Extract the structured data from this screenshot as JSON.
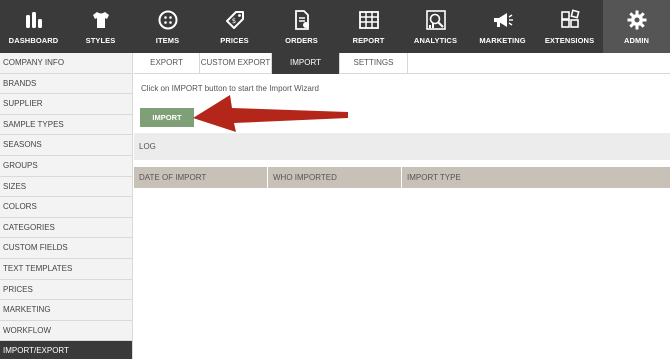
{
  "nav": {
    "items": [
      {
        "label": "DASHBOARD",
        "icon": "dashboard-icon"
      },
      {
        "label": "STYLES",
        "icon": "shirt-icon"
      },
      {
        "label": "ITEMS",
        "icon": "button-icon"
      },
      {
        "label": "PRICES",
        "icon": "price-tag-icon"
      },
      {
        "label": "ORDERS",
        "icon": "document-icon"
      },
      {
        "label": "REPORT",
        "icon": "table-icon"
      },
      {
        "label": "ANALYTICS",
        "icon": "analytics-icon"
      },
      {
        "label": "MARKETING",
        "icon": "megaphone-icon"
      },
      {
        "label": "EXTENSIONS",
        "icon": "extensions-icon"
      },
      {
        "label": "ADMIN",
        "icon": "gear-icon",
        "active": true
      }
    ]
  },
  "sidebar": {
    "items": [
      {
        "label": "COMPANY INFO"
      },
      {
        "label": "BRANDS"
      },
      {
        "label": "SUPPLIER"
      },
      {
        "label": "SAMPLE TYPES"
      },
      {
        "label": "SEASONS"
      },
      {
        "label": "GROUPS"
      },
      {
        "label": "SIZES"
      },
      {
        "label": "COLORS"
      },
      {
        "label": "CATEGORIES"
      },
      {
        "label": "CUSTOM FIELDS"
      },
      {
        "label": "TEXT TEMPLATES"
      },
      {
        "label": "PRICES"
      },
      {
        "label": "MARKETING"
      },
      {
        "label": "WORKFLOW"
      },
      {
        "label": "IMPORT/EXPORT",
        "active": true
      }
    ]
  },
  "tabs": [
    {
      "label": "EXPORT"
    },
    {
      "label": "CUSTOM EXPORT"
    },
    {
      "label": "IMPORT",
      "active": true
    },
    {
      "label": "SETTINGS"
    }
  ],
  "main": {
    "instruction": "Click on IMPORT button to start the Import Wizard",
    "import_button": "IMPORT",
    "log_label": "LOG",
    "columns": [
      "DATE OF IMPORT",
      "WHO IMPORTED",
      "IMPORT TYPE"
    ]
  },
  "colors": {
    "nav_bg": "#3a3a3a",
    "button_green": "#7f9f77",
    "arrow_red": "#b5261a",
    "table_header": "#c8c1b8"
  }
}
